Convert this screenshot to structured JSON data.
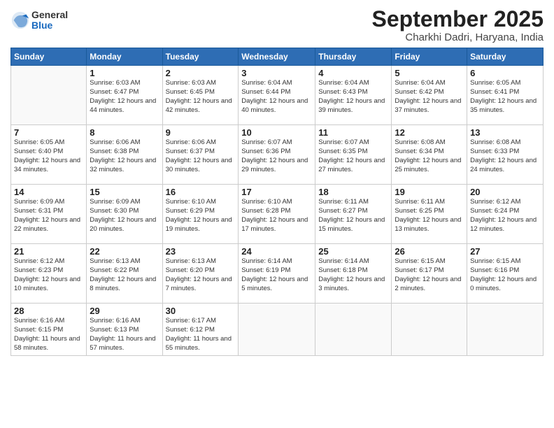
{
  "logo": {
    "general": "General",
    "blue": "Blue"
  },
  "title": {
    "month": "September 2025",
    "location": "Charkhi Dadri, Haryana, India"
  },
  "weekdays": [
    "Sunday",
    "Monday",
    "Tuesday",
    "Wednesday",
    "Thursday",
    "Friday",
    "Saturday"
  ],
  "weeks": [
    [
      {
        "day": null
      },
      {
        "day": 1,
        "sunrise": "6:03 AM",
        "sunset": "6:47 PM",
        "daylight": "12 hours and 44 minutes."
      },
      {
        "day": 2,
        "sunrise": "6:03 AM",
        "sunset": "6:45 PM",
        "daylight": "12 hours and 42 minutes."
      },
      {
        "day": 3,
        "sunrise": "6:04 AM",
        "sunset": "6:44 PM",
        "daylight": "12 hours and 40 minutes."
      },
      {
        "day": 4,
        "sunrise": "6:04 AM",
        "sunset": "6:43 PM",
        "daylight": "12 hours and 39 minutes."
      },
      {
        "day": 5,
        "sunrise": "6:04 AM",
        "sunset": "6:42 PM",
        "daylight": "12 hours and 37 minutes."
      },
      {
        "day": 6,
        "sunrise": "6:05 AM",
        "sunset": "6:41 PM",
        "daylight": "12 hours and 35 minutes."
      }
    ],
    [
      {
        "day": 7,
        "sunrise": "6:05 AM",
        "sunset": "6:40 PM",
        "daylight": "12 hours and 34 minutes."
      },
      {
        "day": 8,
        "sunrise": "6:06 AM",
        "sunset": "6:38 PM",
        "daylight": "12 hours and 32 minutes."
      },
      {
        "day": 9,
        "sunrise": "6:06 AM",
        "sunset": "6:37 PM",
        "daylight": "12 hours and 30 minutes."
      },
      {
        "day": 10,
        "sunrise": "6:07 AM",
        "sunset": "6:36 PM",
        "daylight": "12 hours and 29 minutes."
      },
      {
        "day": 11,
        "sunrise": "6:07 AM",
        "sunset": "6:35 PM",
        "daylight": "12 hours and 27 minutes."
      },
      {
        "day": 12,
        "sunrise": "6:08 AM",
        "sunset": "6:34 PM",
        "daylight": "12 hours and 25 minutes."
      },
      {
        "day": 13,
        "sunrise": "6:08 AM",
        "sunset": "6:33 PM",
        "daylight": "12 hours and 24 minutes."
      }
    ],
    [
      {
        "day": 14,
        "sunrise": "6:09 AM",
        "sunset": "6:31 PM",
        "daylight": "12 hours and 22 minutes."
      },
      {
        "day": 15,
        "sunrise": "6:09 AM",
        "sunset": "6:30 PM",
        "daylight": "12 hours and 20 minutes."
      },
      {
        "day": 16,
        "sunrise": "6:10 AM",
        "sunset": "6:29 PM",
        "daylight": "12 hours and 19 minutes."
      },
      {
        "day": 17,
        "sunrise": "6:10 AM",
        "sunset": "6:28 PM",
        "daylight": "12 hours and 17 minutes."
      },
      {
        "day": 18,
        "sunrise": "6:11 AM",
        "sunset": "6:27 PM",
        "daylight": "12 hours and 15 minutes."
      },
      {
        "day": 19,
        "sunrise": "6:11 AM",
        "sunset": "6:25 PM",
        "daylight": "12 hours and 13 minutes."
      },
      {
        "day": 20,
        "sunrise": "6:12 AM",
        "sunset": "6:24 PM",
        "daylight": "12 hours and 12 minutes."
      }
    ],
    [
      {
        "day": 21,
        "sunrise": "6:12 AM",
        "sunset": "6:23 PM",
        "daylight": "12 hours and 10 minutes."
      },
      {
        "day": 22,
        "sunrise": "6:13 AM",
        "sunset": "6:22 PM",
        "daylight": "12 hours and 8 minutes."
      },
      {
        "day": 23,
        "sunrise": "6:13 AM",
        "sunset": "6:20 PM",
        "daylight": "12 hours and 7 minutes."
      },
      {
        "day": 24,
        "sunrise": "6:14 AM",
        "sunset": "6:19 PM",
        "daylight": "12 hours and 5 minutes."
      },
      {
        "day": 25,
        "sunrise": "6:14 AM",
        "sunset": "6:18 PM",
        "daylight": "12 hours and 3 minutes."
      },
      {
        "day": 26,
        "sunrise": "6:15 AM",
        "sunset": "6:17 PM",
        "daylight": "12 hours and 2 minutes."
      },
      {
        "day": 27,
        "sunrise": "6:15 AM",
        "sunset": "6:16 PM",
        "daylight": "12 hours and 0 minutes."
      }
    ],
    [
      {
        "day": 28,
        "sunrise": "6:16 AM",
        "sunset": "6:15 PM",
        "daylight": "11 hours and 58 minutes."
      },
      {
        "day": 29,
        "sunrise": "6:16 AM",
        "sunset": "6:13 PM",
        "daylight": "11 hours and 57 minutes."
      },
      {
        "day": 30,
        "sunrise": "6:17 AM",
        "sunset": "6:12 PM",
        "daylight": "11 hours and 55 minutes."
      },
      {
        "day": null
      },
      {
        "day": null
      },
      {
        "day": null
      },
      {
        "day": null
      }
    ]
  ]
}
